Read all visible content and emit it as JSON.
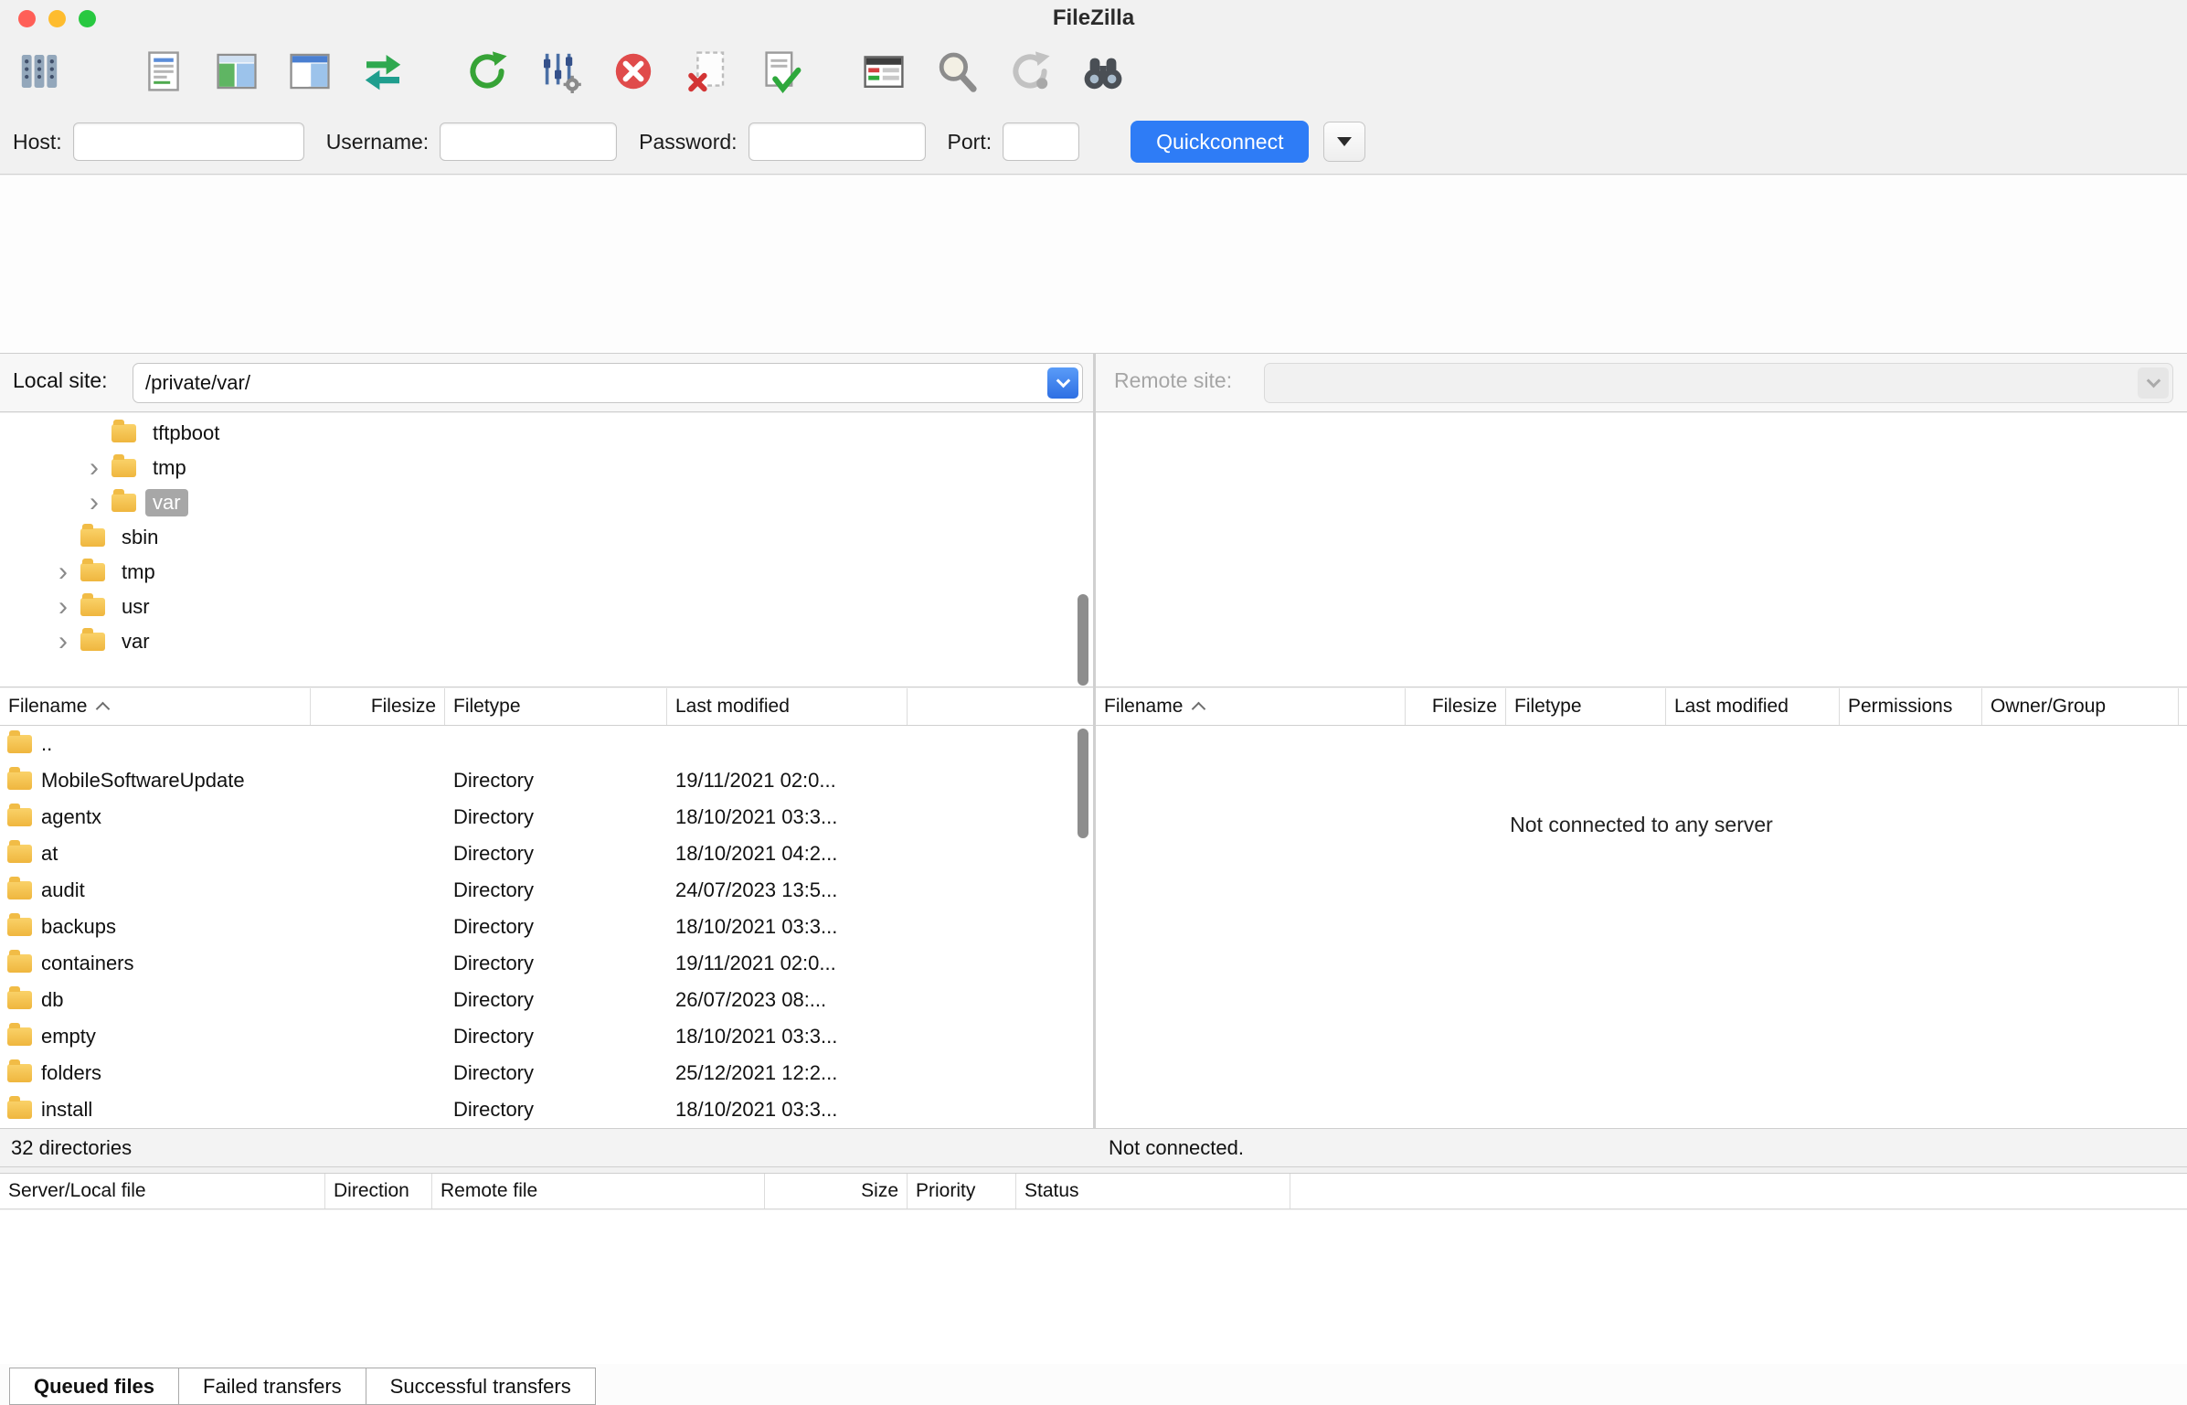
{
  "window": {
    "title": "FileZilla"
  },
  "toolbar": {
    "icons": [
      "site-manager-icon",
      "message-log-toggle-icon",
      "local-tree-toggle-icon",
      "remote-tree-toggle-icon",
      "sync-browsing-icon",
      "refresh-icon",
      "filter-settings-icon",
      "cancel-icon",
      "file-delete-icon",
      "file-check-icon",
      "transfer-queue-icon",
      "search-icon",
      "reconnect-icon",
      "find-files-binoculars-icon"
    ]
  },
  "quickconnect": {
    "host_label": "Host:",
    "username_label": "Username:",
    "password_label": "Password:",
    "port_label": "Port:",
    "button_label": "Quickconnect",
    "host_value": "",
    "username_value": "",
    "password_value": "",
    "port_value": ""
  },
  "local_pane": {
    "site_label": "Local site:",
    "site_value": "/private/var/",
    "tree": [
      {
        "name": "tftpboot",
        "level": 2,
        "expandable": false,
        "selected": false
      },
      {
        "name": "tmp",
        "level": 2,
        "expandable": true,
        "selected": false
      },
      {
        "name": "var",
        "level": 2,
        "expandable": true,
        "selected": true
      },
      {
        "name": "sbin",
        "level": 1,
        "expandable": false,
        "selected": false
      },
      {
        "name": "tmp",
        "level": 1,
        "expandable": true,
        "selected": false
      },
      {
        "name": "usr",
        "level": 1,
        "expandable": true,
        "selected": false
      },
      {
        "name": "var",
        "level": 1,
        "expandable": true,
        "selected": false
      }
    ],
    "columns": [
      "Filename",
      "Filesize",
      "Filetype",
      "Last modified"
    ],
    "rows": [
      {
        "name": "..",
        "filesize": "",
        "filetype": "",
        "last_modified": ""
      },
      {
        "name": "MobileSoftwareUpdate",
        "filesize": "",
        "filetype": "Directory",
        "last_modified": "19/11/2021 02:0..."
      },
      {
        "name": "agentx",
        "filesize": "",
        "filetype": "Directory",
        "last_modified": "18/10/2021 03:3..."
      },
      {
        "name": "at",
        "filesize": "",
        "filetype": "Directory",
        "last_modified": "18/10/2021 04:2..."
      },
      {
        "name": "audit",
        "filesize": "",
        "filetype": "Directory",
        "last_modified": "24/07/2023 13:5..."
      },
      {
        "name": "backups",
        "filesize": "",
        "filetype": "Directory",
        "last_modified": "18/10/2021 03:3..."
      },
      {
        "name": "containers",
        "filesize": "",
        "filetype": "Directory",
        "last_modified": "19/11/2021 02:0..."
      },
      {
        "name": "db",
        "filesize": "",
        "filetype": "Directory",
        "last_modified": "26/07/2023 08:..."
      },
      {
        "name": "empty",
        "filesize": "",
        "filetype": "Directory",
        "last_modified": "18/10/2021 03:3..."
      },
      {
        "name": "folders",
        "filesize": "",
        "filetype": "Directory",
        "last_modified": "25/12/2021 12:2..."
      },
      {
        "name": "install",
        "filesize": "",
        "filetype": "Directory",
        "last_modified": "18/10/2021 03:3..."
      }
    ],
    "status": "32 directories"
  },
  "remote_pane": {
    "site_label": "Remote site:",
    "site_value": "",
    "columns": [
      "Filename",
      "Filesize",
      "Filetype",
      "Last modified",
      "Permissions",
      "Owner/Group"
    ],
    "empty_message": "Not connected to any server",
    "status": "Not connected."
  },
  "transfer_queue": {
    "columns": [
      "Server/Local file",
      "Direction",
      "Remote file",
      "Size",
      "Priority",
      "Status"
    ],
    "tabs": [
      {
        "label": "Queued files",
        "selected": true
      },
      {
        "label": "Failed transfers",
        "selected": false
      },
      {
        "label": "Successful transfers",
        "selected": false
      }
    ]
  }
}
